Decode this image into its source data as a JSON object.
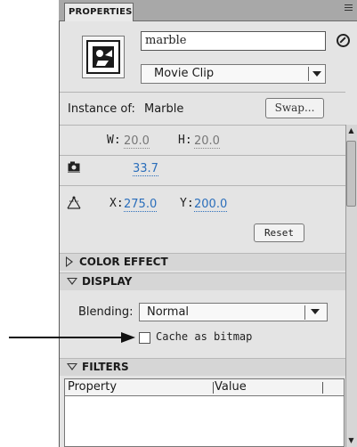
{
  "panel": {
    "tab_label": "PROPERTIES"
  },
  "instance": {
    "name_value": "marble",
    "type_value": "Movie Clip",
    "instance_of_label": "Instance of:",
    "instance_of_value": "Marble",
    "swap_label": "Swap..."
  },
  "position_size": {
    "w_label": "W:",
    "w_value": "20.0",
    "h_label": "H:",
    "h_value": "20.0",
    "camera_value": "33.7",
    "x_label": "X:",
    "x_value": "275.0",
    "y_label": "Y:",
    "y_value": "200.0",
    "reset_label": "Reset"
  },
  "sections": {
    "color_effect": "COLOR EFFECT",
    "display": "DISPLAY",
    "filters": "FILTERS"
  },
  "display": {
    "blending_label": "Blending:",
    "blending_value": "Normal",
    "cache_label": "Cache as bitmap",
    "cache_checked": false
  },
  "filters_table": {
    "columns": [
      "Property",
      "Value"
    ]
  }
}
